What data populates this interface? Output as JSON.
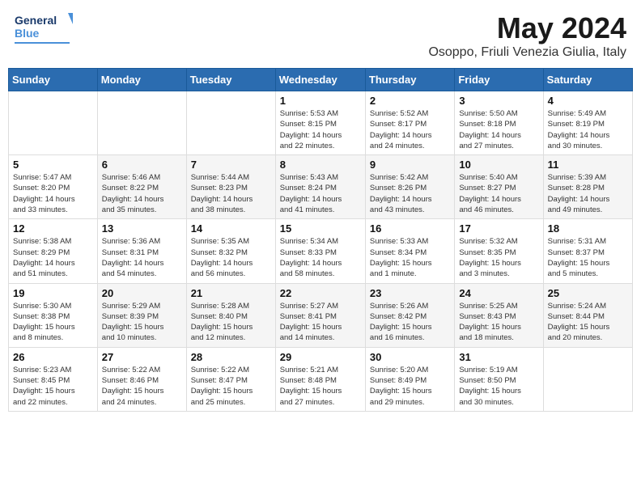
{
  "header": {
    "logo_line1": "General",
    "logo_line2": "Blue",
    "month": "May 2024",
    "location": "Osoppo, Friuli Venezia Giulia, Italy"
  },
  "weekdays": [
    "Sunday",
    "Monday",
    "Tuesday",
    "Wednesday",
    "Thursday",
    "Friday",
    "Saturday"
  ],
  "weeks": [
    [
      {
        "day": "",
        "info": ""
      },
      {
        "day": "",
        "info": ""
      },
      {
        "day": "",
        "info": ""
      },
      {
        "day": "1",
        "info": "Sunrise: 5:53 AM\nSunset: 8:15 PM\nDaylight: 14 hours\nand 22 minutes."
      },
      {
        "day": "2",
        "info": "Sunrise: 5:52 AM\nSunset: 8:17 PM\nDaylight: 14 hours\nand 24 minutes."
      },
      {
        "day": "3",
        "info": "Sunrise: 5:50 AM\nSunset: 8:18 PM\nDaylight: 14 hours\nand 27 minutes."
      },
      {
        "day": "4",
        "info": "Sunrise: 5:49 AM\nSunset: 8:19 PM\nDaylight: 14 hours\nand 30 minutes."
      }
    ],
    [
      {
        "day": "5",
        "info": "Sunrise: 5:47 AM\nSunset: 8:20 PM\nDaylight: 14 hours\nand 33 minutes."
      },
      {
        "day": "6",
        "info": "Sunrise: 5:46 AM\nSunset: 8:22 PM\nDaylight: 14 hours\nand 35 minutes."
      },
      {
        "day": "7",
        "info": "Sunrise: 5:44 AM\nSunset: 8:23 PM\nDaylight: 14 hours\nand 38 minutes."
      },
      {
        "day": "8",
        "info": "Sunrise: 5:43 AM\nSunset: 8:24 PM\nDaylight: 14 hours\nand 41 minutes."
      },
      {
        "day": "9",
        "info": "Sunrise: 5:42 AM\nSunset: 8:26 PM\nDaylight: 14 hours\nand 43 minutes."
      },
      {
        "day": "10",
        "info": "Sunrise: 5:40 AM\nSunset: 8:27 PM\nDaylight: 14 hours\nand 46 minutes."
      },
      {
        "day": "11",
        "info": "Sunrise: 5:39 AM\nSunset: 8:28 PM\nDaylight: 14 hours\nand 49 minutes."
      }
    ],
    [
      {
        "day": "12",
        "info": "Sunrise: 5:38 AM\nSunset: 8:29 PM\nDaylight: 14 hours\nand 51 minutes."
      },
      {
        "day": "13",
        "info": "Sunrise: 5:36 AM\nSunset: 8:31 PM\nDaylight: 14 hours\nand 54 minutes."
      },
      {
        "day": "14",
        "info": "Sunrise: 5:35 AM\nSunset: 8:32 PM\nDaylight: 14 hours\nand 56 minutes."
      },
      {
        "day": "15",
        "info": "Sunrise: 5:34 AM\nSunset: 8:33 PM\nDaylight: 14 hours\nand 58 minutes."
      },
      {
        "day": "16",
        "info": "Sunrise: 5:33 AM\nSunset: 8:34 PM\nDaylight: 15 hours\nand 1 minute."
      },
      {
        "day": "17",
        "info": "Sunrise: 5:32 AM\nSunset: 8:35 PM\nDaylight: 15 hours\nand 3 minutes."
      },
      {
        "day": "18",
        "info": "Sunrise: 5:31 AM\nSunset: 8:37 PM\nDaylight: 15 hours\nand 5 minutes."
      }
    ],
    [
      {
        "day": "19",
        "info": "Sunrise: 5:30 AM\nSunset: 8:38 PM\nDaylight: 15 hours\nand 8 minutes."
      },
      {
        "day": "20",
        "info": "Sunrise: 5:29 AM\nSunset: 8:39 PM\nDaylight: 15 hours\nand 10 minutes."
      },
      {
        "day": "21",
        "info": "Sunrise: 5:28 AM\nSunset: 8:40 PM\nDaylight: 15 hours\nand 12 minutes."
      },
      {
        "day": "22",
        "info": "Sunrise: 5:27 AM\nSunset: 8:41 PM\nDaylight: 15 hours\nand 14 minutes."
      },
      {
        "day": "23",
        "info": "Sunrise: 5:26 AM\nSunset: 8:42 PM\nDaylight: 15 hours\nand 16 minutes."
      },
      {
        "day": "24",
        "info": "Sunrise: 5:25 AM\nSunset: 8:43 PM\nDaylight: 15 hours\nand 18 minutes."
      },
      {
        "day": "25",
        "info": "Sunrise: 5:24 AM\nSunset: 8:44 PM\nDaylight: 15 hours\nand 20 minutes."
      }
    ],
    [
      {
        "day": "26",
        "info": "Sunrise: 5:23 AM\nSunset: 8:45 PM\nDaylight: 15 hours\nand 22 minutes."
      },
      {
        "day": "27",
        "info": "Sunrise: 5:22 AM\nSunset: 8:46 PM\nDaylight: 15 hours\nand 24 minutes."
      },
      {
        "day": "28",
        "info": "Sunrise: 5:22 AM\nSunset: 8:47 PM\nDaylight: 15 hours\nand 25 minutes."
      },
      {
        "day": "29",
        "info": "Sunrise: 5:21 AM\nSunset: 8:48 PM\nDaylight: 15 hours\nand 27 minutes."
      },
      {
        "day": "30",
        "info": "Sunrise: 5:20 AM\nSunset: 8:49 PM\nDaylight: 15 hours\nand 29 minutes."
      },
      {
        "day": "31",
        "info": "Sunrise: 5:19 AM\nSunset: 8:50 PM\nDaylight: 15 hours\nand 30 minutes."
      },
      {
        "day": "",
        "info": ""
      }
    ]
  ]
}
